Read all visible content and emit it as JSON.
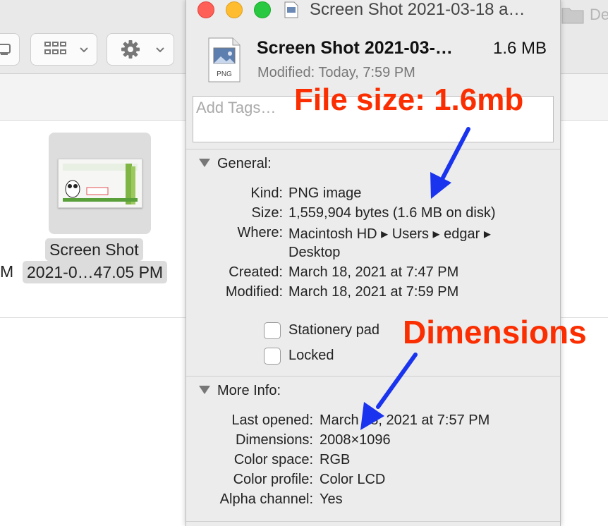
{
  "finder": {
    "partial_title": "De",
    "file_name_line1": "Screen Shot",
    "file_name_line2": "2021-0…47.05 PM",
    "column_fragment": "M",
    "icons": [
      "sidebar-icon",
      "grid-view-icon",
      "gear-icon",
      "folder-icon"
    ]
  },
  "window": {
    "title": "Screen Shot 2021-03-18 a…",
    "controls": [
      "close",
      "minimize",
      "zoom"
    ]
  },
  "header": {
    "file_name": "Screen Shot 2021-03-…",
    "size": "1.6 MB",
    "modified_label": "Modified:",
    "modified_value": "Today, 7:59 PM",
    "icon_label": "PNG"
  },
  "tags": {
    "placeholder": "Add Tags…"
  },
  "general": {
    "title": "General:",
    "rows": [
      {
        "key": "Kind:",
        "value": "PNG image"
      },
      {
        "key": "Size:",
        "value": "1,559,904 bytes (1.6 MB on disk)"
      },
      {
        "key": "Where:",
        "value": "Macintosh HD ▸ Users ▸ edgar ▸"
      },
      {
        "key": "",
        "value": "Desktop"
      },
      {
        "key": "Created:",
        "value": "March 18, 2021 at 7:47 PM"
      },
      {
        "key": "Modified:",
        "value": "March 18, 2021 at 7:59 PM"
      }
    ],
    "checkboxes": [
      {
        "label": "Stationery pad",
        "checked": false
      },
      {
        "label": "Locked",
        "checked": false
      }
    ]
  },
  "more_info": {
    "title": "More Info:",
    "rows": [
      {
        "key": "Last opened:",
        "value": "March 18, 2021 at 7:57 PM"
      },
      {
        "key": "Dimensions:",
        "value": "2008×1096"
      },
      {
        "key": "Color space:",
        "value": "RGB"
      },
      {
        "key": "Color profile:",
        "value": "Color LCD"
      },
      {
        "key": "Alpha channel:",
        "value": "Yes"
      }
    ]
  },
  "annotations": {
    "file_size": "File size: 1.6mb",
    "dimensions": "Dimensions",
    "text_color": "#fb2e01",
    "arrow_color": "#1a33ee"
  }
}
